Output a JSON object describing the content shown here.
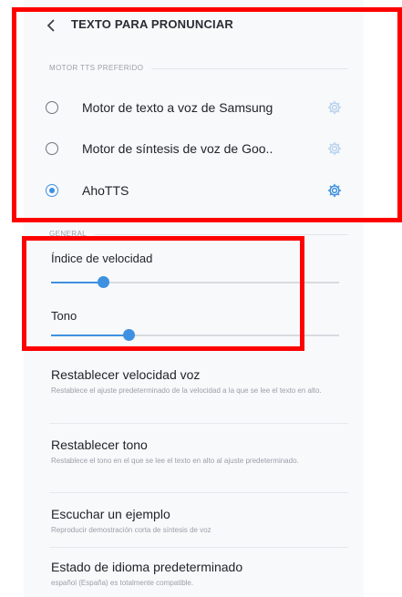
{
  "header": {
    "title": "TEXTO PARA PRONUNCIAR",
    "back_icon": "chevron-left-icon"
  },
  "engine_section": {
    "label": "MOTOR TTS PREFERIDO",
    "engines": [
      {
        "label": "Motor de texto a voz de Samsung",
        "selected": false,
        "icon": "gear-icon"
      },
      {
        "label": "Motor de síntesis de voz de Goo..",
        "selected": false,
        "icon": "gear-icon"
      },
      {
        "label": "AhoTTS",
        "selected": true,
        "icon": "gear-icon"
      }
    ]
  },
  "general_section": {
    "label": "GENERAL",
    "speech_rate": {
      "label": "Índice de velocidad",
      "value": 0.18
    },
    "pitch": {
      "label": "Tono",
      "value": 0.27
    }
  },
  "settings": [
    {
      "title": "Restablecer velocidad voz",
      "subtitle": "Restablece el ajuste predeterminado de la velocidad a la que se lee el texto en alto."
    },
    {
      "title": "Restablecer tono",
      "subtitle": "Restablece el tono en el que se lee el texto en alto al ajuste predeterminado."
    },
    {
      "title": "Escuchar un ejemplo",
      "subtitle": "Reproducir demostración corta de síntesis de voz"
    },
    {
      "title": "Estado de idioma predeterminado",
      "subtitle": "español (España) es totalmente compatible."
    }
  ],
  "colors": {
    "accent": "#3e91e0",
    "highlight": "#ff0000",
    "gear_inactive": "#b9d3ee",
    "gear_active": "#3e91e0"
  }
}
